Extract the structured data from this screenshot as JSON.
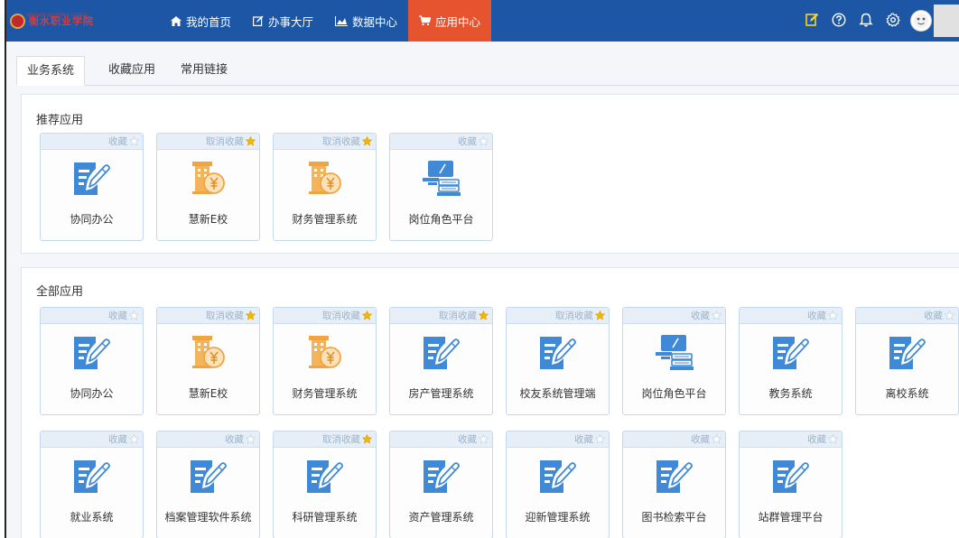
{
  "header": {
    "logo_text": "衡水职业学院",
    "logo_sub": "HENGSHUI VOCATIONAL COLLEGE",
    "nav": [
      {
        "label": "我的首页",
        "icon": "home-icon"
      },
      {
        "label": "办事大厅",
        "icon": "edit-icon"
      },
      {
        "label": "数据中心",
        "icon": "chart-icon"
      },
      {
        "label": "应用中心",
        "icon": "cart-icon",
        "active": true
      }
    ],
    "icons": [
      "note-edit-icon",
      "help-icon",
      "bell-icon",
      "gear-icon"
    ],
    "colors": {
      "bar": "#1c56a4",
      "active": "#e5532f",
      "note_icon": "#f5d327"
    }
  },
  "tabs": [
    {
      "label": "业务系统",
      "active": true
    },
    {
      "label": "收藏应用"
    },
    {
      "label": "常用链接"
    }
  ],
  "recommended": {
    "title": "推荐应用",
    "apps": [
      {
        "name": "协同办公",
        "fav": "收藏",
        "starred": false,
        "icon": "doc-edit"
      },
      {
        "name": "慧新E校",
        "fav": "取消收藏",
        "starred": true,
        "icon": "finance"
      },
      {
        "name": "财务管理系统",
        "fav": "取消收藏",
        "starred": true,
        "icon": "finance"
      },
      {
        "name": "岗位角色平台",
        "fav": "收藏",
        "starred": false,
        "icon": "role-platform"
      }
    ]
  },
  "all": {
    "title": "全部应用",
    "apps": [
      {
        "name": "协同办公",
        "fav": "收藏",
        "starred": false,
        "icon": "doc-edit"
      },
      {
        "name": "慧新E校",
        "fav": "取消收藏",
        "starred": true,
        "icon": "finance"
      },
      {
        "name": "财务管理系统",
        "fav": "取消收藏",
        "starred": true,
        "icon": "finance"
      },
      {
        "name": "房产管理系统",
        "fav": "取消收藏",
        "starred": true,
        "icon": "doc-edit"
      },
      {
        "name": "校友系统管理端",
        "fav": "取消收藏",
        "starred": true,
        "icon": "doc-edit"
      },
      {
        "name": "岗位角色平台",
        "fav": "收藏",
        "starred": false,
        "icon": "role-platform"
      },
      {
        "name": "教务系统",
        "fav": "收藏",
        "starred": false,
        "icon": "doc-edit"
      },
      {
        "name": "离校系统",
        "fav": "收藏",
        "starred": false,
        "icon": "doc-edit"
      },
      {
        "name": "就业系统",
        "fav": "收藏",
        "starred": false,
        "icon": "doc-edit"
      },
      {
        "name": "档案管理软件系统",
        "fav": "收藏",
        "starred": false,
        "icon": "doc-edit"
      },
      {
        "name": "科研管理系统",
        "fav": "取消收藏",
        "starred": true,
        "icon": "doc-edit"
      },
      {
        "name": "资产管理系统",
        "fav": "收藏",
        "starred": false,
        "icon": "doc-edit"
      },
      {
        "name": "迎新管理系统",
        "fav": "收藏",
        "starred": false,
        "icon": "doc-edit"
      },
      {
        "name": "图书检索平台",
        "fav": "收藏",
        "starred": false,
        "icon": "doc-edit"
      },
      {
        "name": "站群管理平台",
        "fav": "收藏",
        "starred": false,
        "icon": "doc-edit"
      }
    ]
  },
  "colors": {
    "doc_icon": "#3f89d6",
    "finance_icon": "#f0a540",
    "star_on": "#f5b800",
    "star_off": "#ffffff"
  }
}
